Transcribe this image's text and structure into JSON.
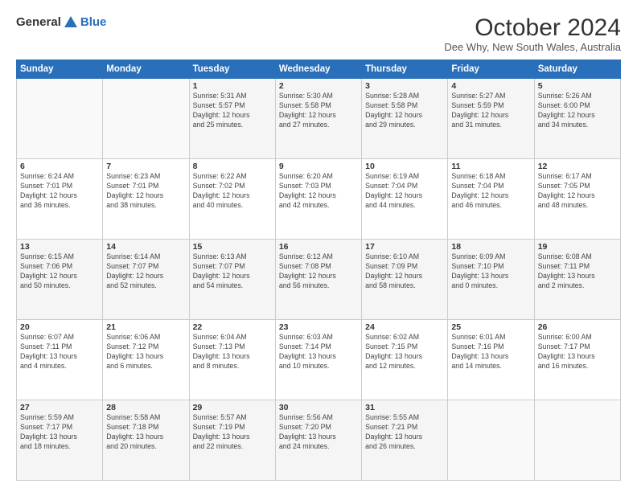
{
  "logo": {
    "general": "General",
    "blue": "Blue"
  },
  "header": {
    "month": "October 2024",
    "location": "Dee Why, New South Wales, Australia"
  },
  "days_of_week": [
    "Sunday",
    "Monday",
    "Tuesday",
    "Wednesday",
    "Thursday",
    "Friday",
    "Saturday"
  ],
  "weeks": [
    [
      {
        "day": "",
        "content": ""
      },
      {
        "day": "",
        "content": ""
      },
      {
        "day": "1",
        "content": "Sunrise: 5:31 AM\nSunset: 5:57 PM\nDaylight: 12 hours\nand 25 minutes."
      },
      {
        "day": "2",
        "content": "Sunrise: 5:30 AM\nSunset: 5:58 PM\nDaylight: 12 hours\nand 27 minutes."
      },
      {
        "day": "3",
        "content": "Sunrise: 5:28 AM\nSunset: 5:58 PM\nDaylight: 12 hours\nand 29 minutes."
      },
      {
        "day": "4",
        "content": "Sunrise: 5:27 AM\nSunset: 5:59 PM\nDaylight: 12 hours\nand 31 minutes."
      },
      {
        "day": "5",
        "content": "Sunrise: 5:26 AM\nSunset: 6:00 PM\nDaylight: 12 hours\nand 34 minutes."
      }
    ],
    [
      {
        "day": "6",
        "content": "Sunrise: 6:24 AM\nSunset: 7:01 PM\nDaylight: 12 hours\nand 36 minutes."
      },
      {
        "day": "7",
        "content": "Sunrise: 6:23 AM\nSunset: 7:01 PM\nDaylight: 12 hours\nand 38 minutes."
      },
      {
        "day": "8",
        "content": "Sunrise: 6:22 AM\nSunset: 7:02 PM\nDaylight: 12 hours\nand 40 minutes."
      },
      {
        "day": "9",
        "content": "Sunrise: 6:20 AM\nSunset: 7:03 PM\nDaylight: 12 hours\nand 42 minutes."
      },
      {
        "day": "10",
        "content": "Sunrise: 6:19 AM\nSunset: 7:04 PM\nDaylight: 12 hours\nand 44 minutes."
      },
      {
        "day": "11",
        "content": "Sunrise: 6:18 AM\nSunset: 7:04 PM\nDaylight: 12 hours\nand 46 minutes."
      },
      {
        "day": "12",
        "content": "Sunrise: 6:17 AM\nSunset: 7:05 PM\nDaylight: 12 hours\nand 48 minutes."
      }
    ],
    [
      {
        "day": "13",
        "content": "Sunrise: 6:15 AM\nSunset: 7:06 PM\nDaylight: 12 hours\nand 50 minutes."
      },
      {
        "day": "14",
        "content": "Sunrise: 6:14 AM\nSunset: 7:07 PM\nDaylight: 12 hours\nand 52 minutes."
      },
      {
        "day": "15",
        "content": "Sunrise: 6:13 AM\nSunset: 7:07 PM\nDaylight: 12 hours\nand 54 minutes."
      },
      {
        "day": "16",
        "content": "Sunrise: 6:12 AM\nSunset: 7:08 PM\nDaylight: 12 hours\nand 56 minutes."
      },
      {
        "day": "17",
        "content": "Sunrise: 6:10 AM\nSunset: 7:09 PM\nDaylight: 12 hours\nand 58 minutes."
      },
      {
        "day": "18",
        "content": "Sunrise: 6:09 AM\nSunset: 7:10 PM\nDaylight: 13 hours\nand 0 minutes."
      },
      {
        "day": "19",
        "content": "Sunrise: 6:08 AM\nSunset: 7:11 PM\nDaylight: 13 hours\nand 2 minutes."
      }
    ],
    [
      {
        "day": "20",
        "content": "Sunrise: 6:07 AM\nSunset: 7:11 PM\nDaylight: 13 hours\nand 4 minutes."
      },
      {
        "day": "21",
        "content": "Sunrise: 6:06 AM\nSunset: 7:12 PM\nDaylight: 13 hours\nand 6 minutes."
      },
      {
        "day": "22",
        "content": "Sunrise: 6:04 AM\nSunset: 7:13 PM\nDaylight: 13 hours\nand 8 minutes."
      },
      {
        "day": "23",
        "content": "Sunrise: 6:03 AM\nSunset: 7:14 PM\nDaylight: 13 hours\nand 10 minutes."
      },
      {
        "day": "24",
        "content": "Sunrise: 6:02 AM\nSunset: 7:15 PM\nDaylight: 13 hours\nand 12 minutes."
      },
      {
        "day": "25",
        "content": "Sunrise: 6:01 AM\nSunset: 7:16 PM\nDaylight: 13 hours\nand 14 minutes."
      },
      {
        "day": "26",
        "content": "Sunrise: 6:00 AM\nSunset: 7:17 PM\nDaylight: 13 hours\nand 16 minutes."
      }
    ],
    [
      {
        "day": "27",
        "content": "Sunrise: 5:59 AM\nSunset: 7:17 PM\nDaylight: 13 hours\nand 18 minutes."
      },
      {
        "day": "28",
        "content": "Sunrise: 5:58 AM\nSunset: 7:18 PM\nDaylight: 13 hours\nand 20 minutes."
      },
      {
        "day": "29",
        "content": "Sunrise: 5:57 AM\nSunset: 7:19 PM\nDaylight: 13 hours\nand 22 minutes."
      },
      {
        "day": "30",
        "content": "Sunrise: 5:56 AM\nSunset: 7:20 PM\nDaylight: 13 hours\nand 24 minutes."
      },
      {
        "day": "31",
        "content": "Sunrise: 5:55 AM\nSunset: 7:21 PM\nDaylight: 13 hours\nand 26 minutes."
      },
      {
        "day": "",
        "content": ""
      },
      {
        "day": "",
        "content": ""
      }
    ]
  ]
}
